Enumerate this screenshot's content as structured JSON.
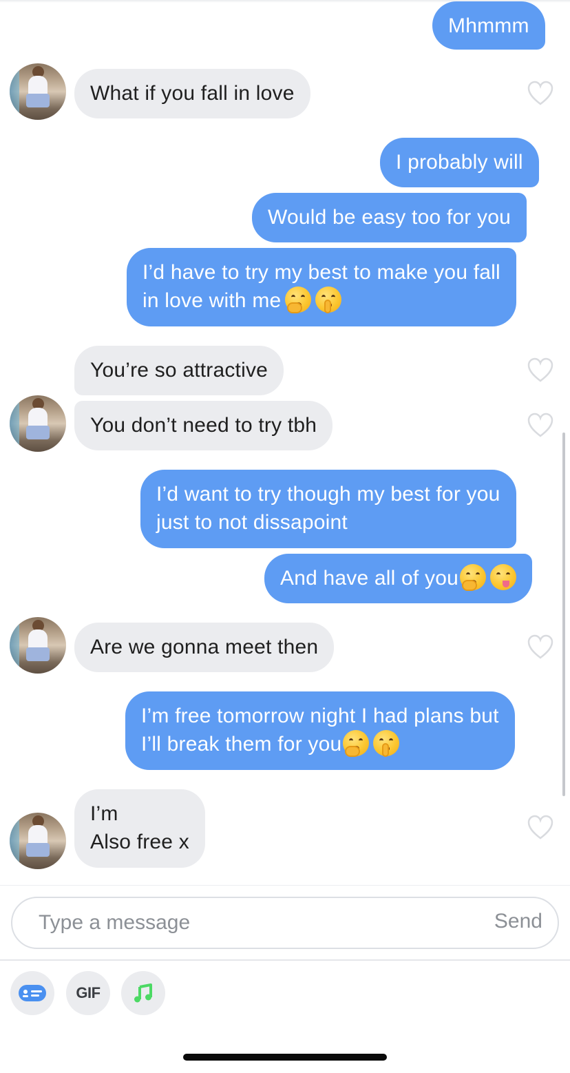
{
  "messages": [
    {
      "side": "sent",
      "lines": [
        "Mhmmm"
      ],
      "emojis": []
    },
    {
      "side": "received",
      "lines": [
        "What if you fall in love"
      ],
      "emojis": []
    },
    {
      "side": "sent",
      "lines": [
        "I probably will"
      ],
      "emojis": []
    },
    {
      "side": "sent",
      "lines": [
        "Would be easy too for you"
      ],
      "emojis": []
    },
    {
      "side": "sent",
      "lines": [
        "I’d have to try my best to make you fall",
        "in love with me"
      ],
      "emojis": [
        "face-with-hand-over-mouth",
        "face-with-finger-over-lips"
      ]
    },
    {
      "side": "received",
      "lines": [
        "You’re so attractive"
      ],
      "emojis": []
    },
    {
      "side": "received",
      "lines": [
        "You don’t need to try tbh"
      ],
      "emojis": []
    },
    {
      "side": "sent",
      "lines": [
        "I’d want to try though my best for you",
        "just to not dissapoint"
      ],
      "emojis": []
    },
    {
      "side": "sent",
      "lines": [
        "And have all of you"
      ],
      "emojis": [
        "face-with-hand-over-mouth",
        "face-savoring-food"
      ]
    },
    {
      "side": "received",
      "lines": [
        "Are we gonna meet then"
      ],
      "emojis": []
    },
    {
      "side": "sent",
      "lines": [
        "I’m free tomorrow night I had plans but",
        "I’ll break them for you"
      ],
      "emojis": [
        "face-with-hand-over-mouth",
        "face-with-finger-over-lips"
      ]
    },
    {
      "side": "received",
      "lines": [
        "I’m",
        "Also free x"
      ],
      "emojis": []
    }
  ],
  "composer": {
    "placeholder": "Type a message",
    "value": "",
    "send_label": "Send"
  },
  "toolbar": {
    "cards_icon": "message-card-icon",
    "gif_label": "GIF",
    "music_icon": "music-note-icon"
  },
  "colors": {
    "sent_bubble": "#5e9cf3",
    "received_bubble": "#ebecef",
    "accent_blue": "#4a90f0",
    "music_green": "#4cd964"
  }
}
